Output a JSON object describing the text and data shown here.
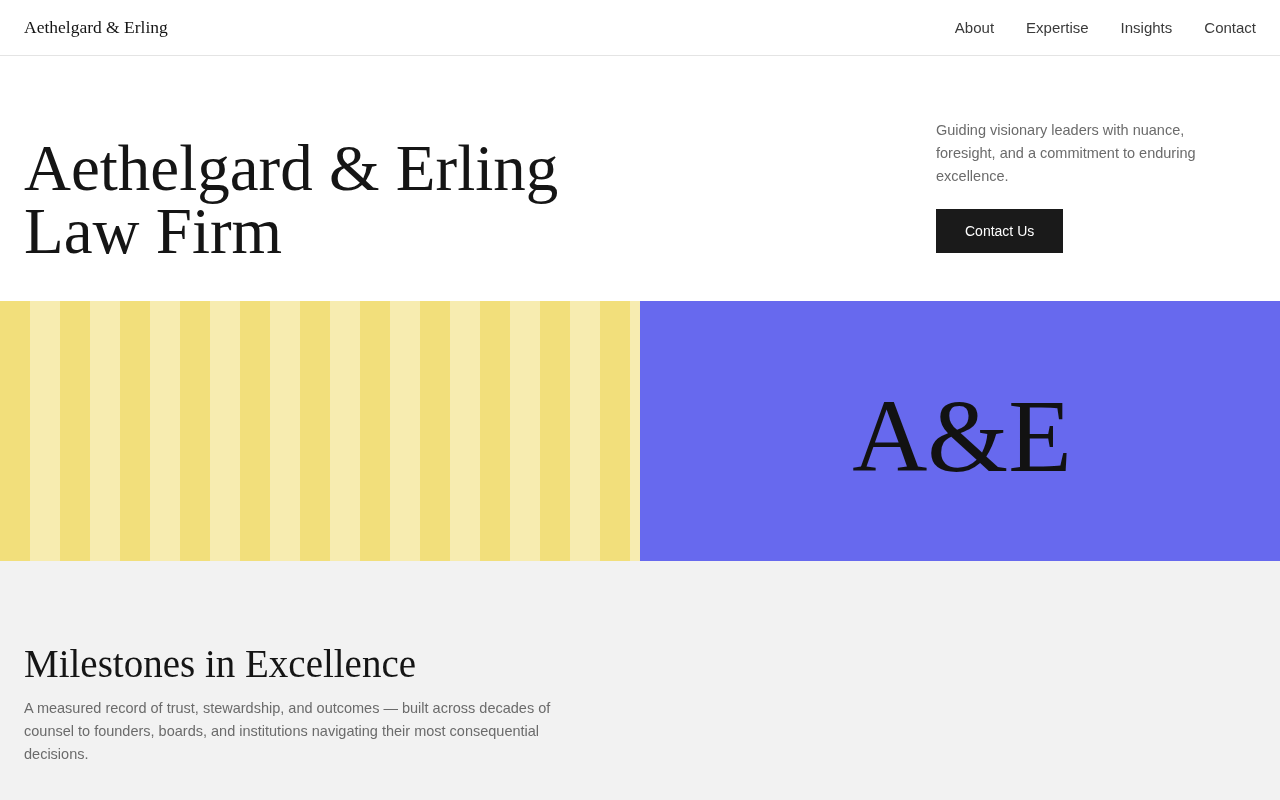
{
  "header": {
    "logo": "Aethelgard & Erling",
    "nav": [
      "About",
      "Expertise",
      "Insights",
      "Contact"
    ]
  },
  "hero": {
    "title": "Aethelgard & Erling Law Firm",
    "tagline": "Guiding visionary leaders with nuance, foresight, and a commitment to enduring excellence.",
    "cta": "Contact Us"
  },
  "banner": {
    "monogram": "A&E"
  },
  "milestones": {
    "heading": "Milestones in Excellence",
    "intro": "A measured record of trust, stewardship, and outcomes — built across decades of counsel to founders, boards, and institutions navigating their most consequential decisions."
  }
}
